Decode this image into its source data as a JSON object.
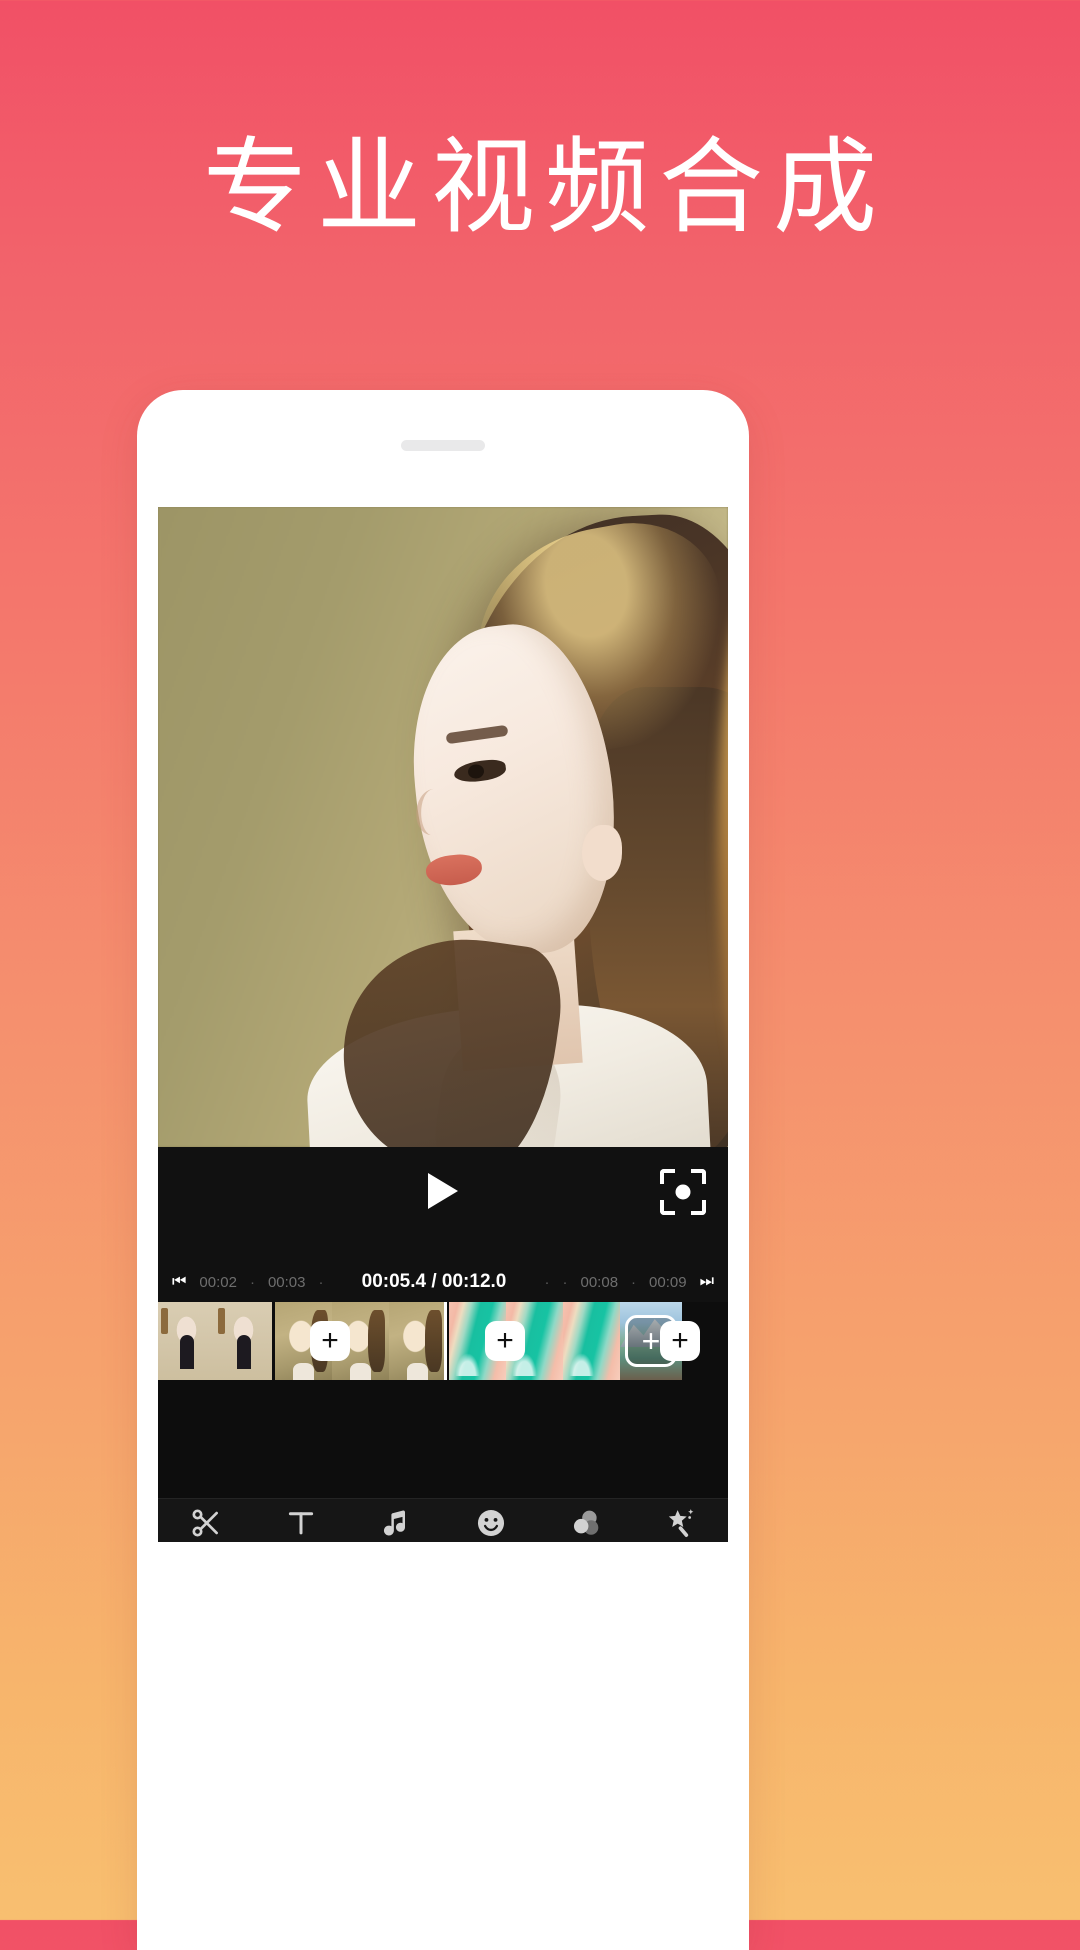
{
  "page": {
    "headline": "专业视频合成",
    "bg_gradient_top": "#f15066",
    "bg_gradient_bottom": "#f8bf70"
  },
  "phone": {
    "speaker_name": "earpiece-speaker"
  },
  "player": {
    "play_icon": "play-icon",
    "fullscreen_icon": "fullscreen-icon"
  },
  "ruler": {
    "prev_icon": "skip-to-start-icon",
    "next_icon": "skip-to-end-icon",
    "left_ticks": [
      "00:02",
      "00:03"
    ],
    "right_ticks": [
      "00:08",
      "00:09"
    ],
    "current_time": "00:05.4",
    "total_time": "00:12.0",
    "time_display": "00:05.4 / 00:12.0"
  },
  "timeline": {
    "add_label": "+",
    "end_add_label": "+",
    "clips": [
      {
        "name": "clip-1",
        "style": "tA",
        "frames": 2
      },
      {
        "name": "clip-2",
        "style": "tB",
        "frames": 3
      },
      {
        "name": "clip-3",
        "style": "tC",
        "frames": 3
      }
    ],
    "accent_color": "#14c79a",
    "playhead_color": "#ffffff"
  },
  "toolbar": {
    "items": [
      {
        "label": "剪辑",
        "icon": "scissors-icon"
      },
      {
        "label": "文字",
        "icon": "text-icon"
      },
      {
        "label": "声音",
        "icon": "music-note-icon"
      },
      {
        "label": "贴纸",
        "icon": "sticker-smiley-icon"
      },
      {
        "label": "滤镜",
        "icon": "filter-circles-icon"
      },
      {
        "label": "特效",
        "icon": "magic-wand-star-icon"
      }
    ]
  }
}
